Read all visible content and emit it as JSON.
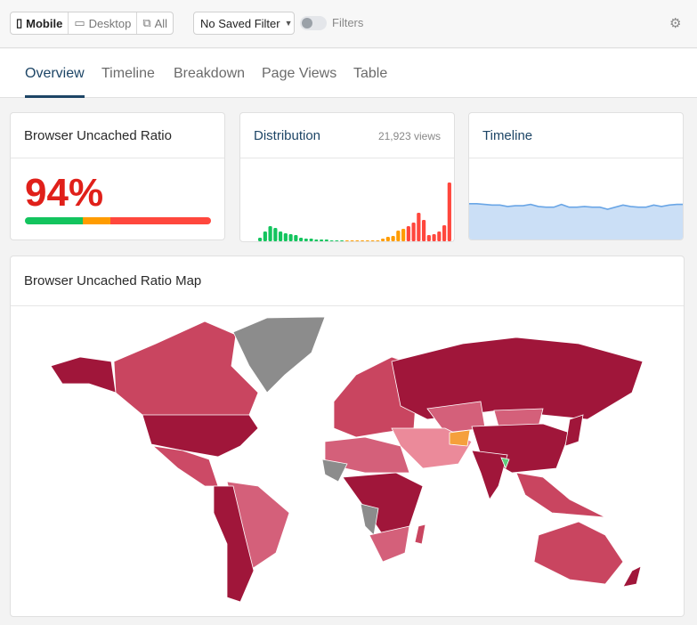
{
  "toolbar": {
    "device_options": [
      "Mobile",
      "Desktop",
      "All"
    ],
    "selected_device": "Mobile",
    "saved_filter": "No Saved Filter",
    "filters_label": "Filters",
    "filters_enabled": false
  },
  "tabs": [
    {
      "label": "Overview",
      "active": true
    },
    {
      "label": "Timeline"
    },
    {
      "label": "Breakdown"
    },
    {
      "label": "Page Views"
    },
    {
      "label": "Table"
    }
  ],
  "ratio_card": {
    "title": "Browser Uncached Ratio",
    "value": "94%",
    "segments": [
      {
        "color": "#13c45e",
        "fraction": 0.31
      },
      {
        "color": "#ff9c00",
        "fraction": 0.15
      },
      {
        "color": "#ff473d",
        "fraction": 0.54
      }
    ]
  },
  "distribution_card": {
    "title": "Distribution",
    "views": "21,923 views"
  },
  "timeline_card": {
    "title": "Timeline"
  },
  "map_card": {
    "title": "Browser Uncached Ratio Map"
  },
  "chart_data": [
    {
      "type": "bar",
      "title": "Distribution",
      "values": [
        4,
        11,
        17,
        15,
        11,
        9,
        8,
        7,
        4,
        3,
        3,
        2,
        2,
        2,
        1,
        1,
        0.7,
        1,
        0.7,
        0.7,
        0.7,
        1,
        1,
        1,
        3,
        5,
        6,
        12,
        14,
        17,
        21,
        32,
        24,
        7,
        8,
        11,
        18,
        66
      ],
      "colors": [
        "#13c45e",
        "#ff9c00",
        "#ff473d"
      ],
      "color_breaks": [
        17,
        29
      ]
    },
    {
      "type": "area",
      "title": "Timeline",
      "values": [
        54,
        54,
        53,
        52,
        52,
        50,
        51,
        51,
        53,
        50,
        49,
        49,
        53,
        49,
        49,
        50,
        49,
        49,
        46,
        49,
        52,
        50,
        49,
        49,
        52,
        50,
        52,
        53,
        53
      ],
      "ylim": [
        0,
        100
      ]
    }
  ]
}
